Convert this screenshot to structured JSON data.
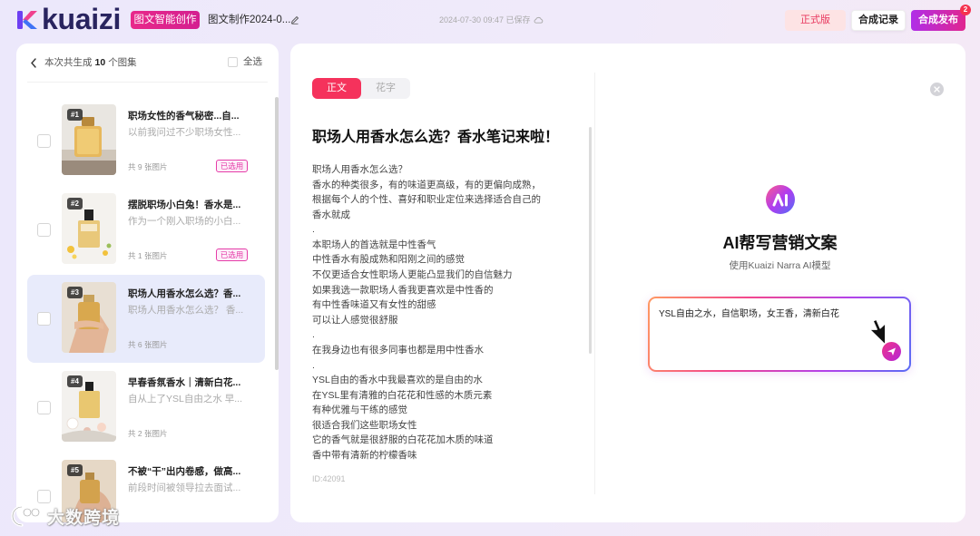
{
  "header": {
    "logo_text": "kuaizi",
    "mode_badge": "图文智能创作",
    "doc_title": "图文制作2024-0...",
    "save_status": "2024-07-30 09:47 已保存",
    "edition_label": "正式版",
    "history_label": "合成记录",
    "publish_label": "合成发布",
    "publish_badge_count": "2"
  },
  "sidebar": {
    "summary_prefix": "本次共生成",
    "summary_count": "10",
    "summary_suffix": "个图集",
    "select_all_label": "全选",
    "items": [
      {
        "index": "#1",
        "title": "职场女性的香气秘密...自...",
        "snippet": "以前我问过不少职场女性...",
        "count": "共 9 张图片",
        "status": "已选用",
        "active": false
      },
      {
        "index": "#2",
        "title": "摆脱职场小白兔！香水是...",
        "snippet": "作为一个刚入职场的小白...",
        "count": "共 1 张图片",
        "status": "已选用",
        "active": false
      },
      {
        "index": "#3",
        "title": "职场人用香水怎么选？香...",
        "snippet": "职场人用香水怎么选？ 香...",
        "count": "共 6 张图片",
        "active": true
      },
      {
        "index": "#4",
        "title": "早春香氛香水｜清新白花...",
        "snippet": "自从上了YSL自由之水 早...",
        "count": "共 2 张图片",
        "active": false
      },
      {
        "index": "#5",
        "title": "不被“干”出内卷感，做高...",
        "snippet": "前段时间被领导拉去面试...",
        "active": false
      }
    ]
  },
  "editor": {
    "tabs": [
      {
        "label": "正文",
        "active": true
      },
      {
        "label": "花字",
        "active": false
      }
    ],
    "title": "职场人用香水怎么选？香水笔记来啦！",
    "lines": [
      "职场人用香水怎么选？",
      "香水的种类很多，有的味道更高级，有的更偏向成熟，",
      "根据每个人的个性、喜好和职业定位来选择适合自己的",
      "香水就成",
      ".",
      "本职场人的首选就是中性香气",
      "中性香水有股成熟和阳刚之间的感觉",
      "不仅更适合女性职场人更能凸显我们的自信魅力",
      "如果我选一款职场人香我更喜欢是中性香的",
      "有中性香味道又有女性的甜感",
      "可以让人感觉很舒服",
      ".",
      "在我身边也有很多同事也都是用中性香水",
      ".",
      "YSL自由的香水中我最喜欢的是自由的水",
      "在YSL里有清雅的白花花和性感的木质元素",
      "有种优雅与干练的感觉",
      "很适合我们这些职场女性",
      "它的香气就是很舒服的白花花加木质的味道",
      "香中带有清新的柠檬香味"
    ],
    "id_label": "ID:42091"
  },
  "ai_panel": {
    "title": "AI帮写营销文案",
    "subtitle": "使用Kuaizi Narra AI模型",
    "prompt_value": "YSL自由之水，自信职场，女王香，清新白花"
  },
  "watermark": "大数跨境",
  "icons": {
    "logo": "kuaizi-logo-icon",
    "edit": "edit-pencil-icon",
    "saved": "cloud-icon",
    "back": "chevron-left-icon",
    "close": "close-circle-icon",
    "ai": "ai-logo-icon",
    "send": "send-plane-icon",
    "cursor": "cursor-arrow-icon"
  },
  "colors": {
    "accent_red": "#f5325c",
    "brand_magenta": "#e0268f",
    "publish_purple": "#b02ee8",
    "used_badge": "#e53ca8",
    "active_row_bg": "#e8ebfb",
    "edition_text": "#e8365d"
  }
}
